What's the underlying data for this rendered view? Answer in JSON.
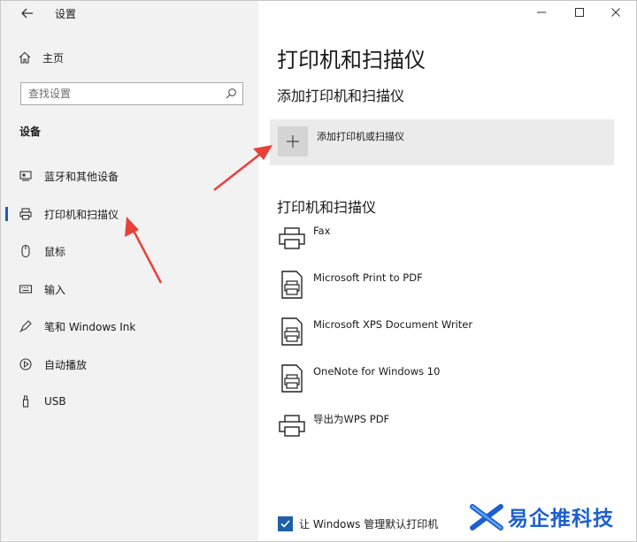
{
  "window": {
    "title": "设置",
    "controls": [
      "minimize-icon",
      "maximize-icon",
      "close-icon"
    ]
  },
  "sidebar": {
    "home_label": "主页",
    "search_placeholder": "查找设置",
    "section_label": "设备",
    "items": [
      {
        "label": "蓝牙和其他设备",
        "icon": "devices-icon"
      },
      {
        "label": "打印机和扫描仪",
        "icon": "printer-icon",
        "active": true
      },
      {
        "label": "鼠标",
        "icon": "mouse-icon"
      },
      {
        "label": "输入",
        "icon": "keyboard-icon"
      },
      {
        "label": "笔和 Windows Ink",
        "icon": "pen-icon"
      },
      {
        "label": "自动播放",
        "icon": "autoplay-icon"
      },
      {
        "label": "USB",
        "icon": "usb-icon"
      }
    ]
  },
  "main": {
    "title": "打印机和扫描仪",
    "add_section_title": "添加打印机和扫描仪",
    "add_button_label": "添加打印机或扫描仪",
    "list_section_title": "打印机和扫描仪",
    "printers": [
      {
        "name": "Fax",
        "icon": "printer-icon"
      },
      {
        "name": "Microsoft Print to PDF",
        "icon": "pdf-printer-icon"
      },
      {
        "name": "Microsoft XPS Document Writer",
        "icon": "pdf-printer-icon"
      },
      {
        "name": "OneNote for Windows 10",
        "icon": "pdf-printer-icon"
      },
      {
        "name": "导出为WPS PDF",
        "icon": "printer-icon"
      }
    ],
    "manage_default_label": "让 Windows 管理默认打印机",
    "manage_default_checked": true
  },
  "watermark": {
    "text": "易企推科技"
  },
  "colors": {
    "accent": "#1f5fa8",
    "annotation_arrow": "#e8413a",
    "sidebar_bg": "#f2f2f2",
    "watermark": "#1d5fcf"
  }
}
